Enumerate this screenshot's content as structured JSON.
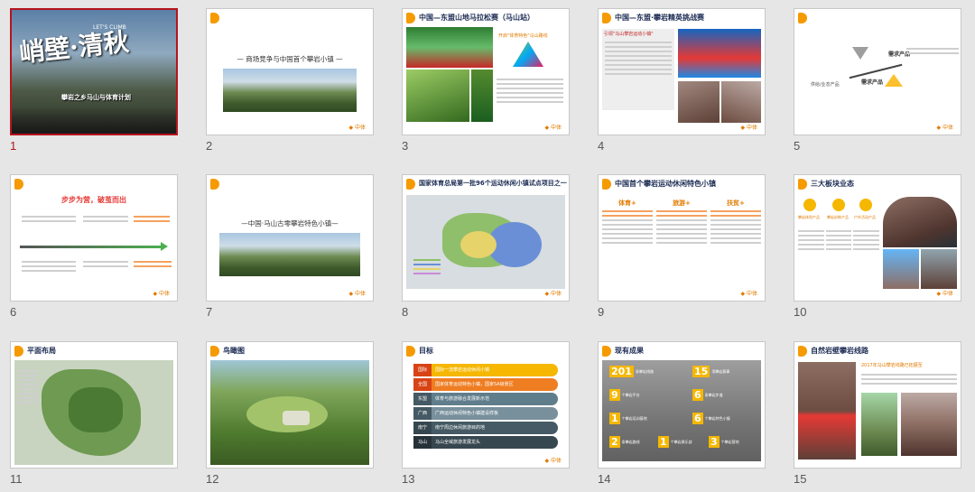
{
  "slides": [
    {
      "num": "1",
      "title_art": "峭壁·清秋",
      "subtitle": "攀岩之乡马山与体育计划",
      "tagline": "LET'S CLIMB",
      "selected": true
    },
    {
      "num": "2",
      "title": "— 商场竞争与中国首个攀岩小镇 —"
    },
    {
      "num": "3",
      "header": "中国—东盟山地马拉松赛（马山站）",
      "highlight": "开启\"体育特色\"马山路线",
      "badge": "CAMP"
    },
    {
      "num": "4",
      "header": "中国—东盟·攀岩精英挑战赛",
      "highlight": "引领\"马山攀岩运动小镇\""
    },
    {
      "num": "5",
      "label_top": "需求产品",
      "label_left": "供给/业态产品",
      "label_right": "需求产品"
    },
    {
      "num": "6",
      "title": "步步为营，破茧而出"
    },
    {
      "num": "7",
      "title": "—中国·马山古零攀岩特色小镇—"
    },
    {
      "num": "8",
      "header": "国家体育总局第一批96个运动休闲小镇试点项目之一"
    },
    {
      "num": "9",
      "header": "中国首个攀岩运动休闲特色小镇",
      "cols": [
        "体育+",
        "旅游+",
        "扶贫+"
      ]
    },
    {
      "num": "10",
      "header": "三大板块业态",
      "items": [
        "攀岩体验产品",
        "攀岩训练产品",
        "户外活动产品"
      ]
    },
    {
      "num": "11",
      "header": "平面布局"
    },
    {
      "num": "12",
      "header": "鸟瞰图"
    },
    {
      "num": "13",
      "header": "目标",
      "rows": [
        {
          "tag": "国际",
          "text": "国际一流攀岩运动休闲小镇"
        },
        {
          "tag": "全国",
          "text": "国家体育运动特色小镇，国家5A级景区"
        },
        {
          "tag": "东盟",
          "text": "体育与旅游融合发展新示范"
        },
        {
          "tag": "广西",
          "text": "广西运动休闲特色小镇建设样板"
        },
        {
          "tag": "南宁",
          "text": "南宁周边休闲旅游目的地"
        },
        {
          "tag": "马山",
          "text": "马山全域旅游发展龙头"
        }
      ]
    },
    {
      "num": "14",
      "header": "现有成果",
      "stats": [
        {
          "v": "201",
          "t": "条攀岩线路"
        },
        {
          "v": "15",
          "t": "项攀岩赛事"
        },
        {
          "v": "9",
          "t": "个攀岩平台"
        },
        {
          "v": "6",
          "t": "条攀岩步道"
        },
        {
          "v": "1",
          "t": "个攀岩培训基地"
        },
        {
          "v": "6",
          "t": "个攀岩特色小镇"
        },
        {
          "v": "2",
          "t": "条攀岩路线"
        },
        {
          "v": "1",
          "t": "个攀岩俱乐部"
        },
        {
          "v": "3",
          "t": "个攀岩营地"
        }
      ]
    },
    {
      "num": "15",
      "header": "自然岩壁攀岩线路",
      "highlight": "2017年马山攀岩线路已拓展至"
    }
  ],
  "colors": {
    "accent": "#f59a00",
    "selected": "#b4151e",
    "navy": "#1a2a52",
    "orange_text": "#e27b00"
  }
}
